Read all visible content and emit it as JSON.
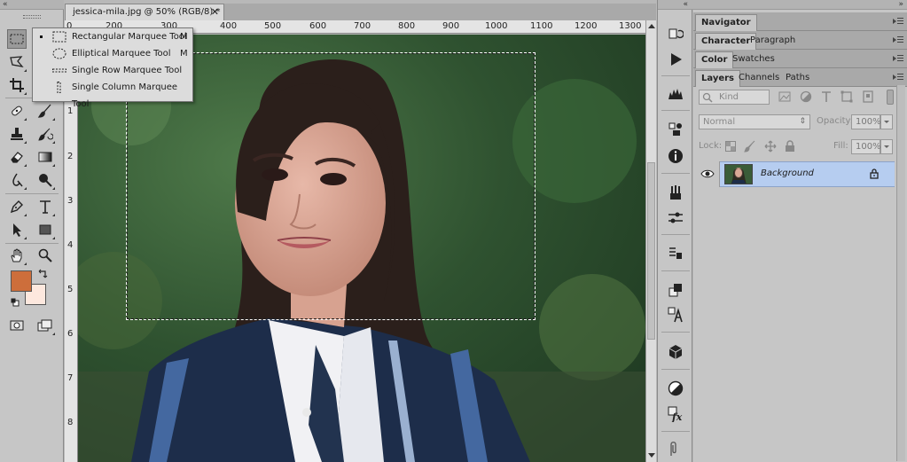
{
  "window": {
    "collapse_left": "«",
    "collapse_mid": "«",
    "expand_right": "»"
  },
  "document": {
    "tab_title": "jessica-mila.jpg @ 50% (RGB/8) *",
    "close_glyph": "✕",
    "ruler_top": [
      "400",
      "500",
      "600",
      "700",
      "800",
      "900",
      "1000",
      "1100",
      "1200",
      "1300"
    ],
    "ruler_top_partial": [
      "0",
      "200",
      "300"
    ],
    "ruler_left": [
      "1",
      "2",
      "3",
      "4",
      "5",
      "6",
      "7",
      "8"
    ]
  },
  "flyout": {
    "items": [
      {
        "label": "Rectangular Marquee Tool",
        "key": "M",
        "icon": "rect-marquee-icon",
        "active": true
      },
      {
        "label": "Elliptical Marquee Tool",
        "key": "M",
        "icon": "ellipse-marquee-icon",
        "active": false
      },
      {
        "label": "Single Row Marquee Tool",
        "key": "",
        "icon": "single-row-marquee-icon",
        "active": false
      },
      {
        "label": "Single Column Marquee Tool",
        "key": "",
        "icon": "single-column-marquee-icon",
        "active": false
      }
    ]
  },
  "colors": {
    "foreground": "#cd6e3b",
    "background": "#fde8de",
    "selection": "#b6cdf0"
  },
  "panels": {
    "navigator": "Navigator",
    "character": "Character",
    "paragraph": "Paragraph",
    "color": "Color",
    "swatches": "Swatches",
    "layers": "Layers",
    "channels": "Channels",
    "paths": "Paths",
    "kind_placeholder": "Kind",
    "blend_mode": "Normal",
    "opacity_label": "Opacity:",
    "opacity_value": "100%",
    "lock_label": "Lock:",
    "fill_label": "Fill:",
    "fill_value": "100%",
    "layer_name": "Background"
  }
}
